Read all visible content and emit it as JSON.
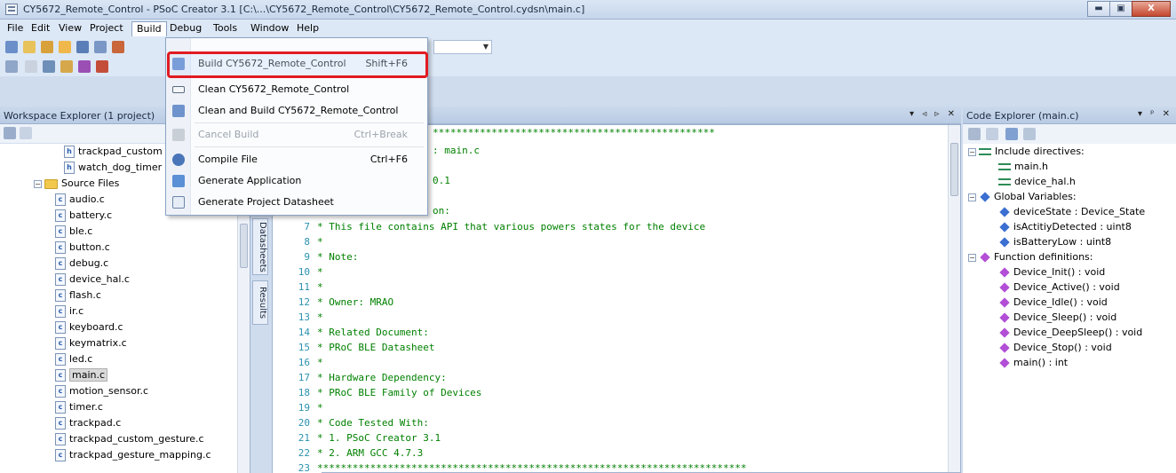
{
  "window": {
    "title": "CY5672_Remote_Control - PSoC Creator 3.1  [C:\\...\\CY5672_Remote_Control\\CY5672_Remote_Control.cydsn\\main.c]",
    "minimize": "▬",
    "maximize": "▣",
    "close": "X"
  },
  "menubar": [
    "File",
    "Edit",
    "View",
    "Project",
    "Build",
    "Debug",
    "Tools",
    "Window",
    "Help"
  ],
  "workspace": {
    "title": "Workspace Explorer (1 project)",
    "items": [
      {
        "label": "trackpad_custom",
        "type": "h"
      },
      {
        "label": "watch_dog_timer",
        "type": "h"
      },
      {
        "label": "Source Files",
        "type": "folder"
      },
      {
        "label": "audio.c",
        "type": "c"
      },
      {
        "label": "battery.c",
        "type": "c"
      },
      {
        "label": "ble.c",
        "type": "c"
      },
      {
        "label": "button.c",
        "type": "c"
      },
      {
        "label": "debug.c",
        "type": "c"
      },
      {
        "label": "device_hal.c",
        "type": "c"
      },
      {
        "label": "flash.c",
        "type": "c"
      },
      {
        "label": "ir.c",
        "type": "c"
      },
      {
        "label": "keyboard.c",
        "type": "c"
      },
      {
        "label": "keymatrix.c",
        "type": "c"
      },
      {
        "label": "led.c",
        "type": "c"
      },
      {
        "label": "main.c",
        "type": "c"
      },
      {
        "label": "motion_sensor.c",
        "type": "c"
      },
      {
        "label": "timer.c",
        "type": "c"
      },
      {
        "label": "trackpad.c",
        "type": "c"
      },
      {
        "label": "trackpad_custom_gesture.c",
        "type": "c"
      },
      {
        "label": "trackpad_gesture_mapping.c",
        "type": "c"
      }
    ],
    "selected": "main.c"
  },
  "side_tabs": [
    "Datasheets",
    "Results"
  ],
  "editor": {
    "controls": "▾ ◃ ▹ ✕",
    "top_fragments": [
      {
        "text": "************************************************"
      },
      {
        "text": ": main.c"
      },
      {
        "text": "0.1"
      },
      {
        "text": "on:"
      }
    ],
    "lines": [
      {
        "num": "7",
        "text": "* This file contains API that various powers states for the device"
      },
      {
        "num": "8",
        "text": "*"
      },
      {
        "num": "9",
        "text": "* Note:"
      },
      {
        "num": "10",
        "text": "*"
      },
      {
        "num": "11",
        "text": "*"
      },
      {
        "num": "12",
        "text": "* Owner: MRAO"
      },
      {
        "num": "13",
        "text": "*"
      },
      {
        "num": "14",
        "text": "* Related Document:"
      },
      {
        "num": "15",
        "text": "* PRoC BLE Datasheet"
      },
      {
        "num": "16",
        "text": "*"
      },
      {
        "num": "17",
        "text": "* Hardware Dependency:"
      },
      {
        "num": "18",
        "text": "* PRoC BLE Family of Devices"
      },
      {
        "num": "19",
        "text": "*"
      },
      {
        "num": "20",
        "text": "* Code Tested With:"
      },
      {
        "num": "21",
        "text": "* 1. PSoC Creator 3.1"
      },
      {
        "num": "22",
        "text": "* 2. ARM GCC 4.7.3"
      },
      {
        "num": "23",
        "text": "*************************************************************************"
      }
    ]
  },
  "code_explorer": {
    "title": "Code Explorer (main.c)",
    "controls": "▾ ᵖ ✕",
    "rows": [
      {
        "label": "Include directives:",
        "kind": "group-inc"
      },
      {
        "label": "main.h",
        "kind": "inc"
      },
      {
        "label": "device_hal.h",
        "kind": "inc"
      },
      {
        "label": "Global Variables:",
        "kind": "group-var"
      },
      {
        "label": "deviceState : Device_State",
        "kind": "var"
      },
      {
        "label": "isActitiyDetected : uint8",
        "kind": "var"
      },
      {
        "label": "isBatteryLow : uint8",
        "kind": "var"
      },
      {
        "label": "Function definitions:",
        "kind": "group-fn"
      },
      {
        "label": "Device_Init() : void",
        "kind": "fn"
      },
      {
        "label": "Device_Active() : void",
        "kind": "fn"
      },
      {
        "label": "Device_Idle() : void",
        "kind": "fn"
      },
      {
        "label": "Device_Sleep() : void",
        "kind": "fn"
      },
      {
        "label": "Device_DeepSleep() : void",
        "kind": "fn"
      },
      {
        "label": "Device_Stop() : void",
        "kind": "fn"
      },
      {
        "label": "main() : int",
        "kind": "fn"
      }
    ]
  },
  "build_menu": {
    "items": [
      {
        "label": "Build CY5672_Remote_Control",
        "shortcut": "Shift+F6",
        "disabled": false,
        "highlight": true
      },
      {
        "label": "Clean CY5672_Remote_Control",
        "shortcut": "",
        "disabled": false
      },
      {
        "label": "Clean and Build CY5672_Remote_Control",
        "shortcut": "",
        "disabled": false
      },
      {
        "label": "Cancel Build",
        "shortcut": "Ctrl+Break",
        "disabled": true
      },
      {
        "label": "Compile File",
        "shortcut": "Ctrl+F6",
        "disabled": false
      },
      {
        "label": "Generate Application",
        "shortcut": "",
        "disabled": false
      },
      {
        "label": "Generate Project Datasheet",
        "shortcut": "",
        "disabled": false
      }
    ]
  },
  "colors": {
    "highlight_border": "#e11b22",
    "code_comment": "#008000",
    "line_number": "#2b91af"
  }
}
